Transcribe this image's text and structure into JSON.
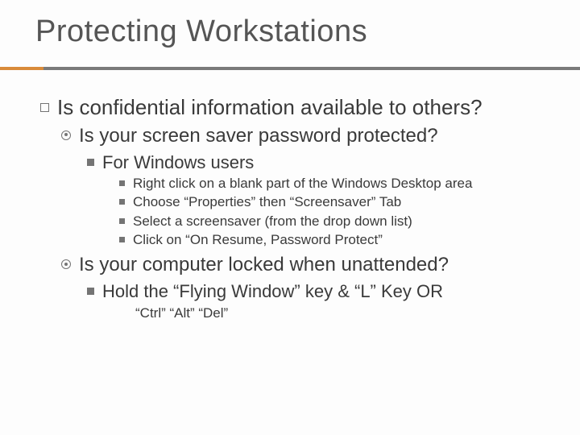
{
  "title": "Protecting Workstations",
  "l1": "Is confidential information available to others?",
  "l2a": "Is your screen saver password protected?",
  "l3a": "For Windows users",
  "l4a": "Right click on a blank part of the Windows Desktop area",
  "l4b": "Choose “Properties” then “Screensaver” Tab",
  "l4c": "Select a screensaver (from the drop down list)",
  "l4d": "Click on “On Resume, Password Protect”",
  "l2b": "Is your computer locked when unattended?",
  "l3b": "Hold the “Flying Window” key & “L” Key OR",
  "l3b_cont": "“Ctrl” “Alt” “Del”"
}
